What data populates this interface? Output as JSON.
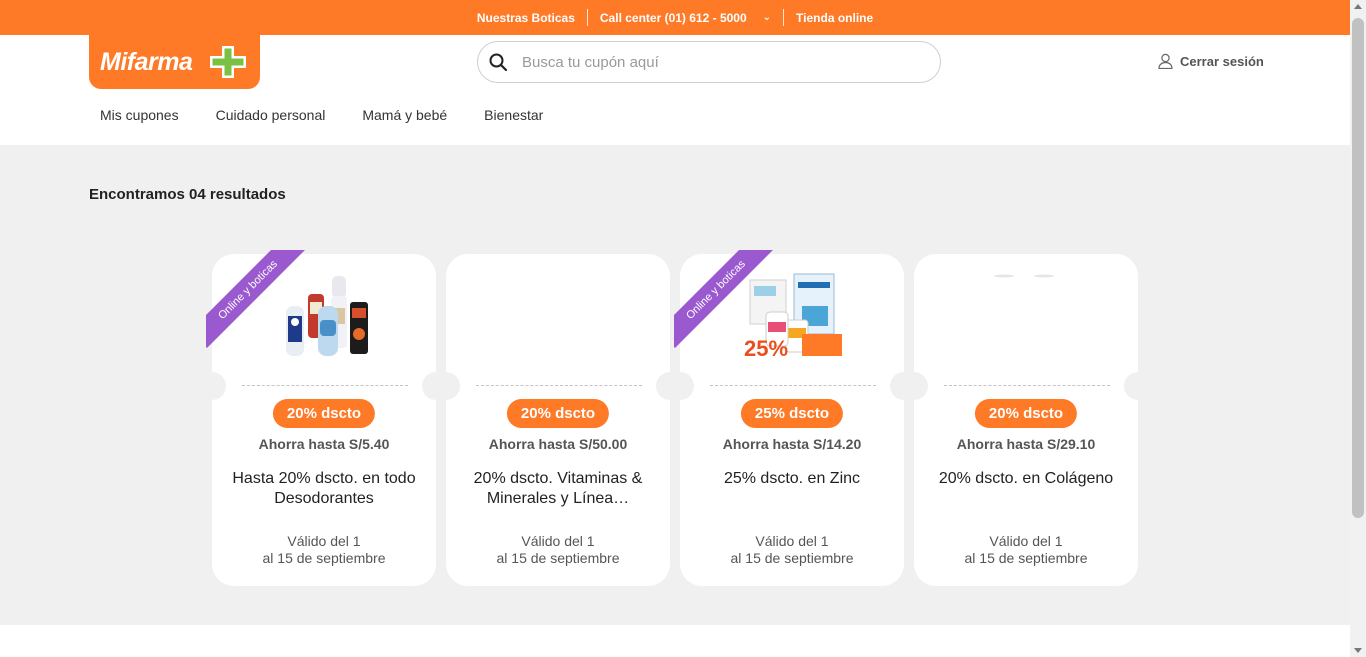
{
  "topbar": {
    "items": [
      "Nuestras Boticas",
      "Call center (01) 612 - 5000",
      "Tienda online"
    ],
    "bg_color": "#ff7a27"
  },
  "header": {
    "logo_text": "Mifarma",
    "search_placeholder": "Busca tu cupón aquí",
    "logout_label": "Cerrar sesión",
    "nav": [
      "Mis cupones",
      "Cuidado personal",
      "Mamá y bebé",
      "Bienestar"
    ]
  },
  "results_text": "Encontramos 04 resultados",
  "coupons": [
    {
      "ribbon": "Online y boticas",
      "image": "deodorants-products",
      "discount": "20% dscto",
      "savings": "Ahorra hasta S/5.40",
      "title": "Hasta 20% dscto. en todo Desodorantes",
      "valid_line1": "Válido del 1",
      "valid_line2": "al 15 de septiembre"
    },
    {
      "ribbon": "",
      "image": "",
      "discount": "20% dscto",
      "savings": "Ahorra hasta S/50.00",
      "title": "20% dscto. Vitaminas & Minerales y Línea…",
      "valid_line1": "Válido del 1",
      "valid_line2": "al 15 de septiembre"
    },
    {
      "ribbon": "Online y boticas",
      "image": "zinc-products",
      "discount": "25% dscto",
      "savings": "Ahorra hasta S/14.20",
      "title": "25% dscto. en Zinc",
      "valid_line1": "Válido del 1",
      "valid_line2": "al 15 de septiembre"
    },
    {
      "ribbon": "",
      "image": "",
      "discount": "20% dscto",
      "savings": "Ahorra hasta S/29.10",
      "title": "20% dscto. en Colágeno",
      "valid_line1": "Válido del 1",
      "valid_line2": "al 15 de septiembre"
    }
  ],
  "colors": {
    "accent": "#ff7a27",
    "ribbon": "#9b59d0",
    "background": "#f0f0f0"
  }
}
